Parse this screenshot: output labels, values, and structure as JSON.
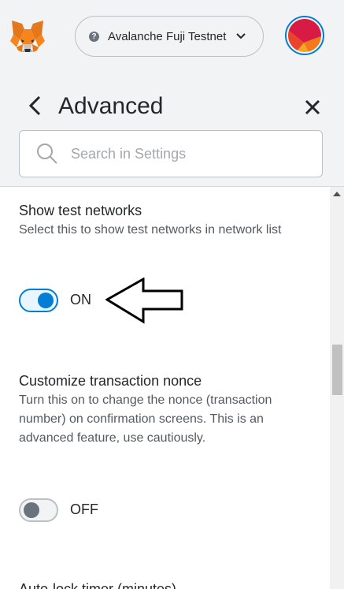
{
  "header": {
    "network": {
      "name": "Avalanche Fuji Testnet",
      "icon": "?"
    },
    "icons": {
      "logo": "metamask-fox-icon",
      "chevron": "chevron-down-icon",
      "avatar": "account-avatar-icon"
    }
  },
  "settings": {
    "title": "Advanced",
    "back_icon": "arrow-left-icon",
    "close_icon": "close-icon",
    "search": {
      "placeholder": "Search in Settings",
      "value": "",
      "icon": "search-icon"
    }
  },
  "items": [
    {
      "title": "Show test networks",
      "description": "Select this to show test networks in network list",
      "toggle": {
        "state": true,
        "label": "ON"
      }
    },
    {
      "title": "Customize transaction nonce",
      "description": "Turn this on to change the nonce (transaction number) on confirmation screens. This is an advanced feature, use cautiously.",
      "toggle": {
        "state": false,
        "label": "OFF"
      }
    },
    {
      "title": "Auto-lock timer (minutes)"
    }
  ],
  "colors": {
    "accent": "#037dd6",
    "header_bg": "#f2f3f4",
    "text": "#24272a",
    "muted_text": "#535a61",
    "toggle_off": "#6a737d"
  }
}
